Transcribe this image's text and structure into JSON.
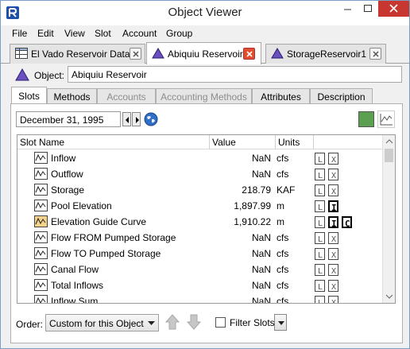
{
  "window": {
    "title": "Object Viewer"
  },
  "menu": [
    "File",
    "Edit",
    "View",
    "Slot",
    "Account",
    "Group"
  ],
  "doc_tabs": [
    {
      "label": "El Vado Reservoir Data",
      "icon": "table-icon",
      "active": false
    },
    {
      "label": "Abiquiu Reservoir",
      "icon": "reservoir-triangle-icon",
      "active": true
    },
    {
      "label": "StorageReservoir1",
      "icon": "reservoir-triangle-icon",
      "active": false
    }
  ],
  "object": {
    "label": "Object:",
    "value": "Abiquiu Reservoir"
  },
  "sub_tabs": [
    {
      "label": "Slots",
      "state": "active"
    },
    {
      "label": "Methods",
      "state": "normal"
    },
    {
      "label": "Accounts",
      "state": "disabled"
    },
    {
      "label": "Accounting Methods",
      "state": "disabled"
    },
    {
      "label": "Attributes",
      "state": "normal"
    },
    {
      "label": "Description",
      "state": "normal"
    }
  ],
  "date": "December 31, 1995",
  "table": {
    "columns": {
      "name": "Slot Name",
      "value": "Value",
      "units": "Units"
    },
    "rows": [
      {
        "name": "Inflow",
        "value": "NaN",
        "units": "cfs",
        "flags": [
          "L",
          "X"
        ],
        "highlight": false
      },
      {
        "name": "Outflow",
        "value": "NaN",
        "units": "cfs",
        "flags": [
          "L",
          "X"
        ],
        "highlight": false
      },
      {
        "name": "Storage",
        "value": "218.79",
        "units": "KAF",
        "flags": [
          "L",
          "X"
        ],
        "highlight": false
      },
      {
        "name": "Pool Elevation",
        "value": "1,897.99",
        "units": "m",
        "flags": [
          "L",
          "I"
        ],
        "highlight": false
      },
      {
        "name": "Elevation Guide Curve",
        "value": "1,910.22",
        "units": "m",
        "flags": [
          "L",
          "I",
          "C"
        ],
        "highlight": true
      },
      {
        "name": "Flow FROM Pumped Storage",
        "value": "NaN",
        "units": "cfs",
        "flags": [
          "L",
          "X"
        ],
        "highlight": false
      },
      {
        "name": "Flow TO Pumped Storage",
        "value": "NaN",
        "units": "cfs",
        "flags": [
          "L",
          "X"
        ],
        "highlight": false
      },
      {
        "name": "Canal Flow",
        "value": "NaN",
        "units": "cfs",
        "flags": [
          "L",
          "X"
        ],
        "highlight": false
      },
      {
        "name": "Total Inflows",
        "value": "NaN",
        "units": "cfs",
        "flags": [
          "L",
          "X"
        ],
        "highlight": false
      },
      {
        "name": "Inflow Sum",
        "value": "NaN",
        "units": "cfs",
        "flags": [
          "L",
          "X"
        ],
        "highlight": false
      }
    ]
  },
  "bottom": {
    "order_label": "Order:",
    "order_value": "Custom for this Object",
    "filter_label": "Filter Slots",
    "filter_checked": false
  },
  "colors": {
    "close_red": "#c7372f",
    "green_swatch": "#5aa050",
    "reservoir_purple": "#6a4fc0",
    "guide_curve_orange": "#c57a1e"
  }
}
